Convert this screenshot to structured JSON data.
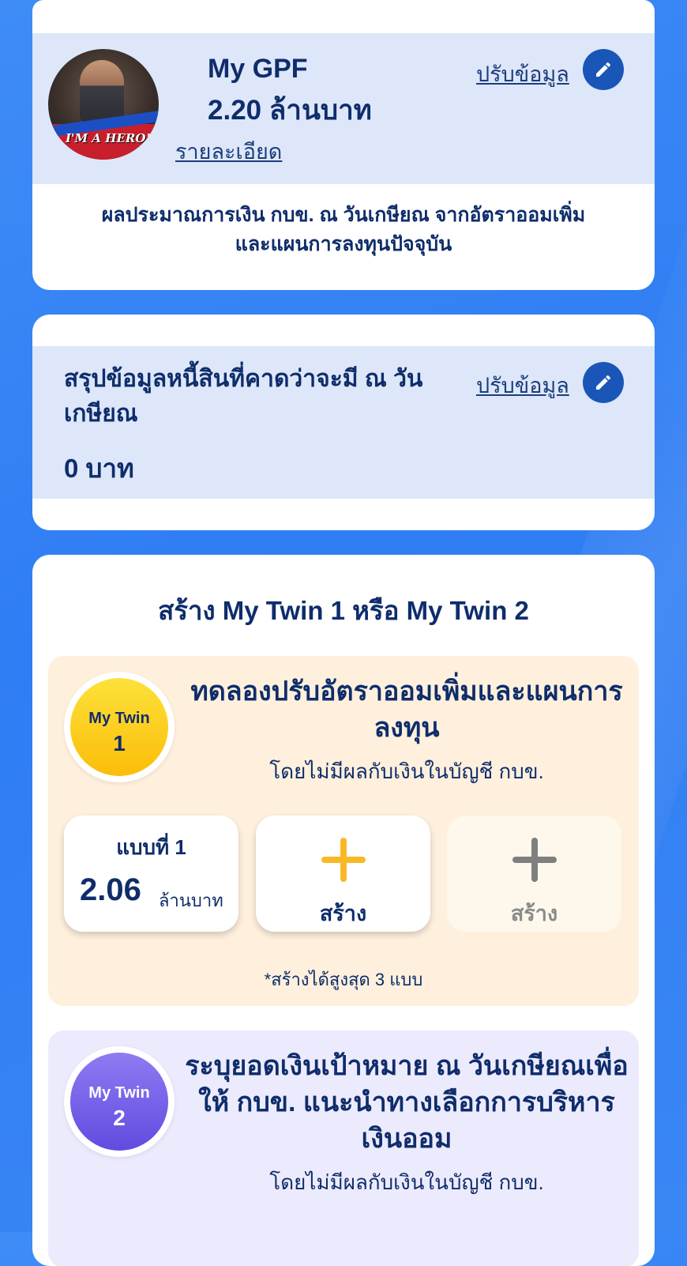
{
  "gpf": {
    "title": "My GPF",
    "amount": "2.20 ล้านบาท",
    "details_link": "รายละเอียด",
    "edit_link": "ปรับข้อมูล",
    "description_line1": "ผลประมาณการเงิน กบข. ณ วันเกษียณ จากอัตราออมเพิ่ม",
    "description_line2": "และแผนการลงทุนปัจจุบัน",
    "avatar_text": "I'M A HERO!"
  },
  "debt": {
    "title": "สรุปข้อมูลหนี้สินที่คาดว่าจะมี ณ วันเกษียณ",
    "amount": "0 บาท",
    "edit_link": "ปรับข้อมูล"
  },
  "twin_section": {
    "heading": "สร้าง My Twin 1  หรือ My Twin 2"
  },
  "twin1": {
    "badge_label": "My Twin",
    "badge_number": "1",
    "title": "ทดลองปรับอัตราออมเพิ่มและแผนการลงทุน",
    "subtitle": "โดยไม่มีผลกับเงินในบัญชี กบข.",
    "plans": [
      {
        "name": "แบบที่ 1",
        "value": "2.06",
        "unit": "ล้านบาท"
      }
    ],
    "create_label": "สร้าง",
    "create_label_disabled": "สร้าง",
    "note": "*สร้างได้สูงสุด 3 แบบ"
  },
  "twin2": {
    "badge_label": "My Twin",
    "badge_number": "2",
    "title": "ระบุยอดเงินเป้าหมาย ณ วันเกษียณเพื่อให้ กบข. แนะนำทางเลือกการบริหารเงินออม",
    "subtitle": "โดยไม่มีผลกับเงินในบัญชี กบข."
  },
  "colors": {
    "background": "#3483f5",
    "navy_text": "#0f2d6b",
    "edit_button": "#1a56b8",
    "twin1_accent": "#f9b826",
    "twin2_accent": "#6b57e6",
    "disabled_plus": "#7f7f7f"
  }
}
